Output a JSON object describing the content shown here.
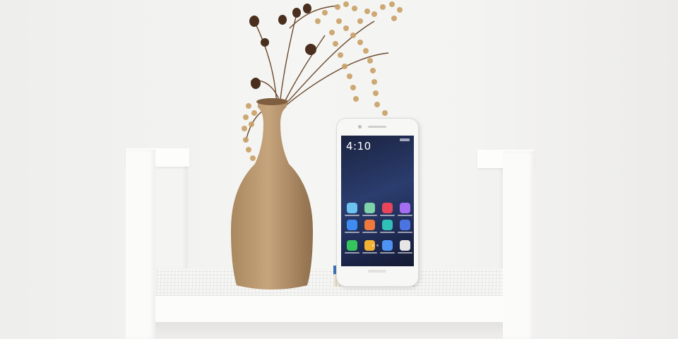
{
  "phone": {
    "clock": "4:10"
  },
  "icons": [
    "phone-app-icon",
    "gallery-icon",
    "music-icon",
    "files-icon",
    "settings-icon",
    "themes-icon",
    "security-icon",
    "tools-icon",
    "dialer-icon",
    "notes-icon",
    "messages-icon",
    "camera-icon"
  ],
  "colors": {
    "app_1": "#6bc3f0",
    "app_2": "#7fd3a8",
    "app_3": "#e8445a",
    "app_4": "#a56df2",
    "app_5": "#3e8cf0",
    "app_6": "#f0783c",
    "app_7": "#2fc0b8",
    "app_8": "#4b74e0",
    "app_9": "#35c45e",
    "app_10": "#f2b233",
    "app_11": "#4f93f2",
    "app_12": "#e6e6e6"
  }
}
